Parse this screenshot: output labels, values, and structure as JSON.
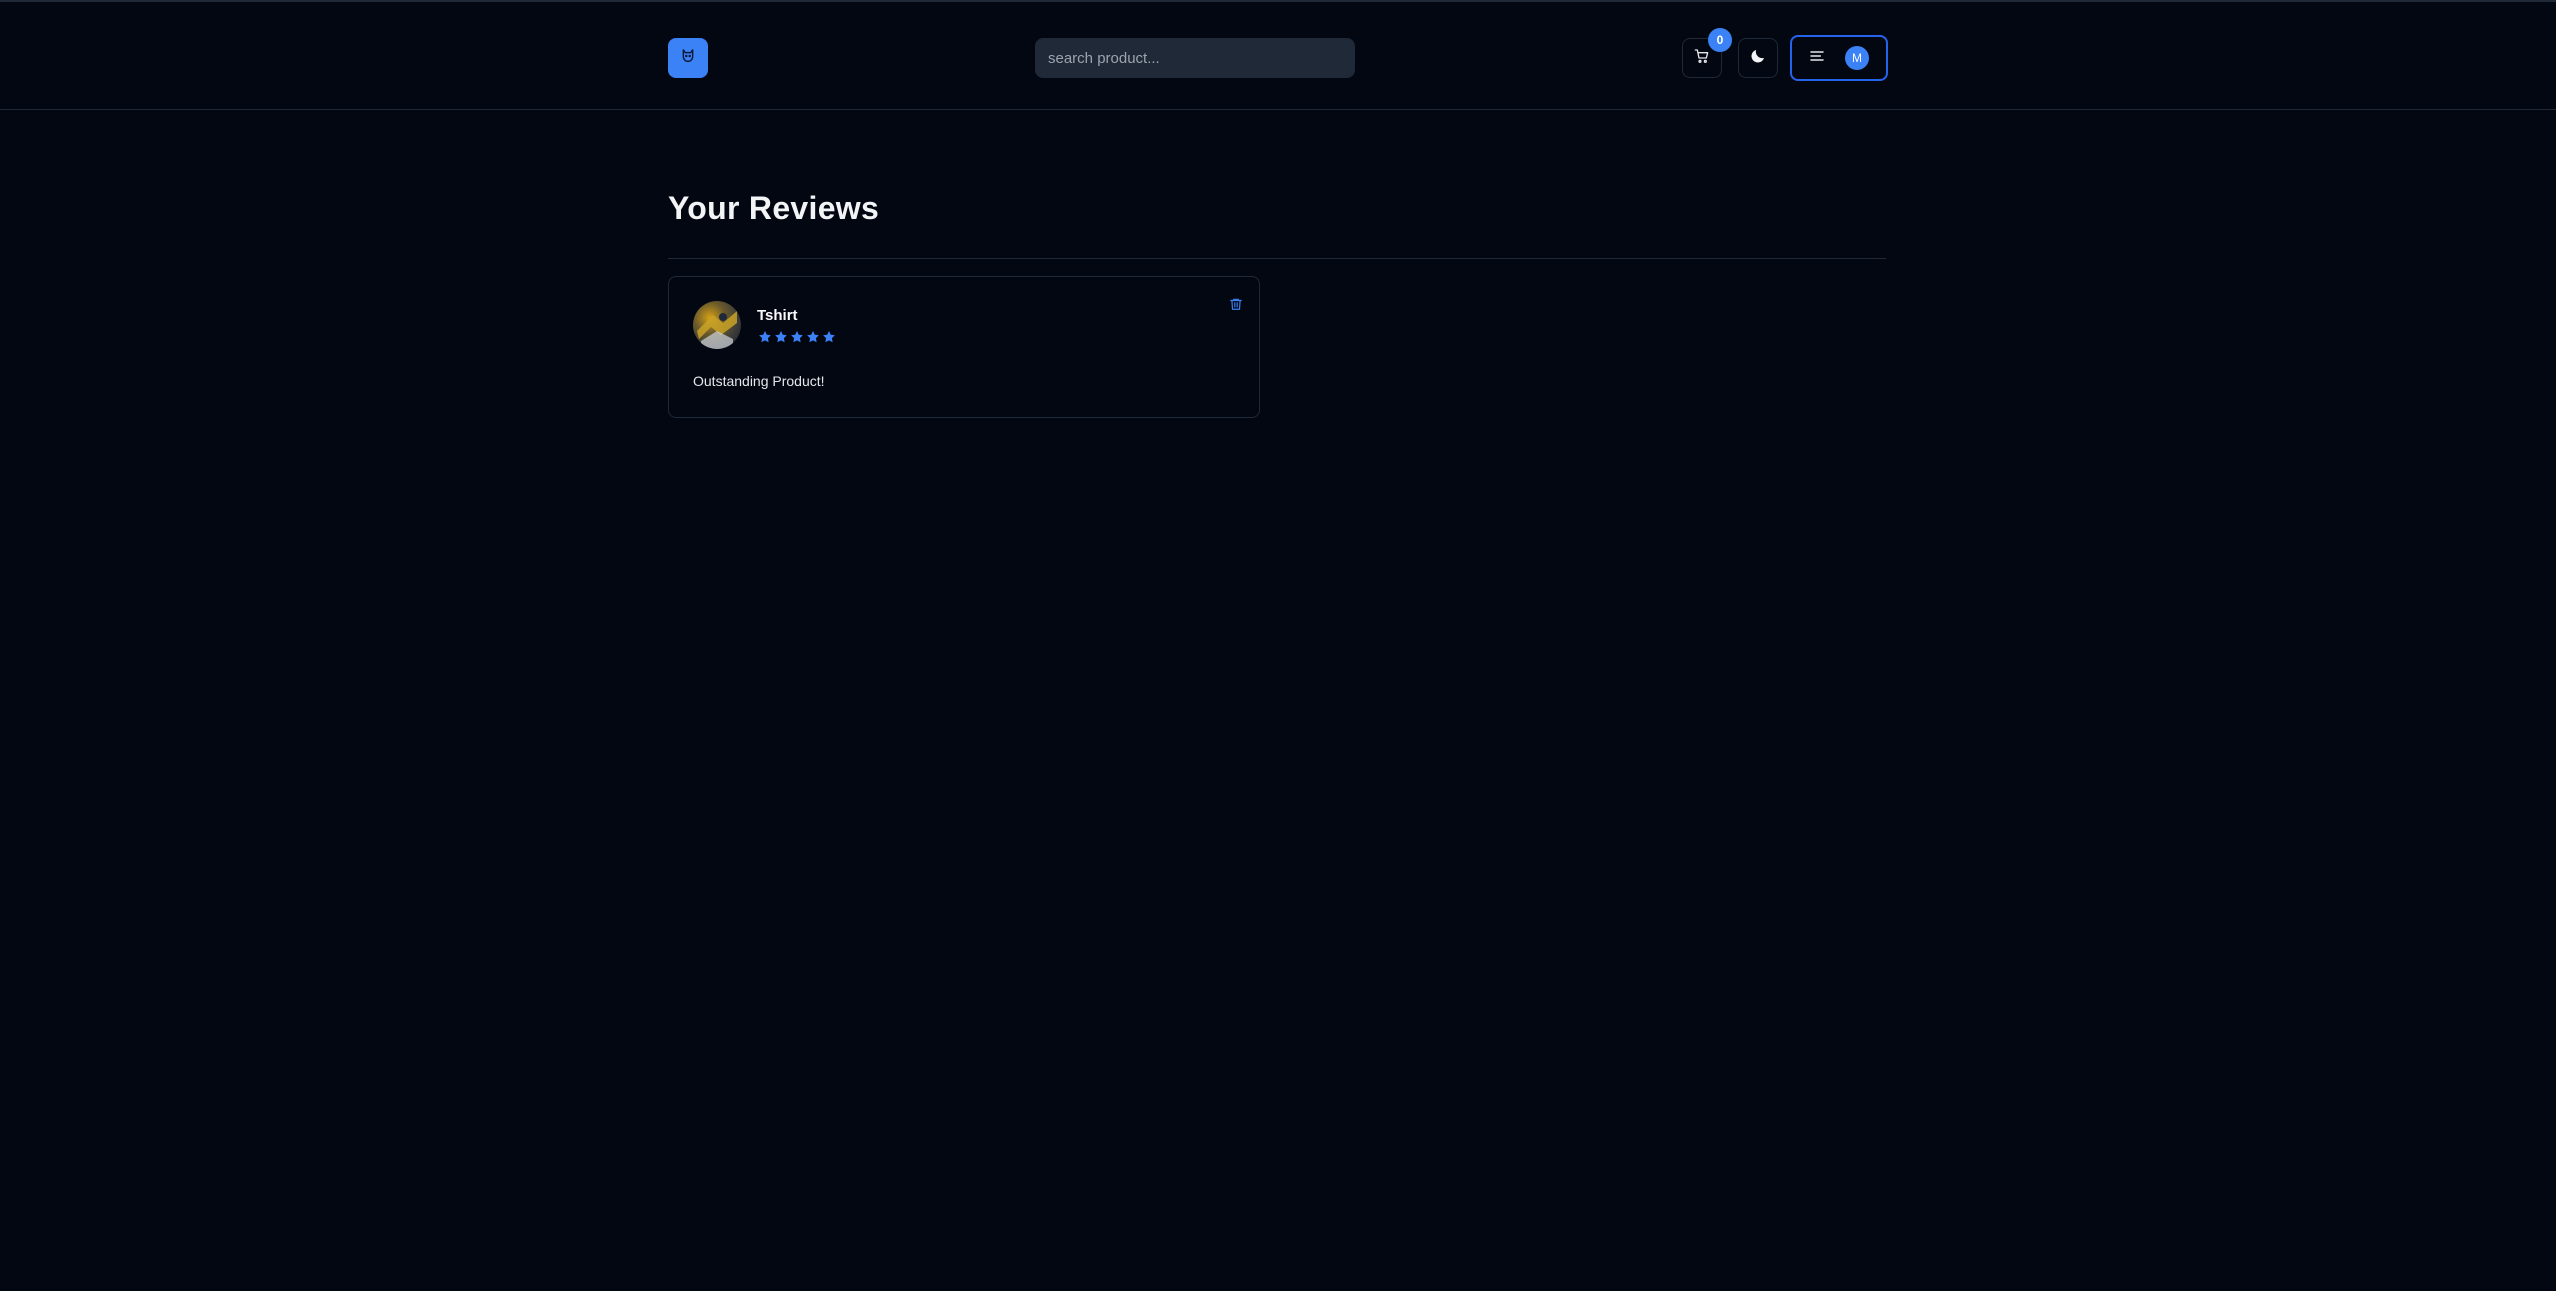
{
  "header": {
    "logo_icon": "cat-icon",
    "search_placeholder": "search product...",
    "cart": {
      "icon": "cart-icon",
      "count": "0"
    },
    "theme_icon": "moon-icon",
    "menu": {
      "icon": "hamburger-icon",
      "avatar_initial": "M"
    }
  },
  "main": {
    "title": "Your Reviews",
    "reviews": [
      {
        "product_name": "Tshirt",
        "rating": 5,
        "rating_max": 5,
        "text": "Outstanding Product!",
        "delete_icon": "trash-icon"
      }
    ]
  },
  "colors": {
    "background": "#030712",
    "accent": "#3b82f6",
    "border": "#1f2937",
    "input_bg": "#1f2937"
  }
}
